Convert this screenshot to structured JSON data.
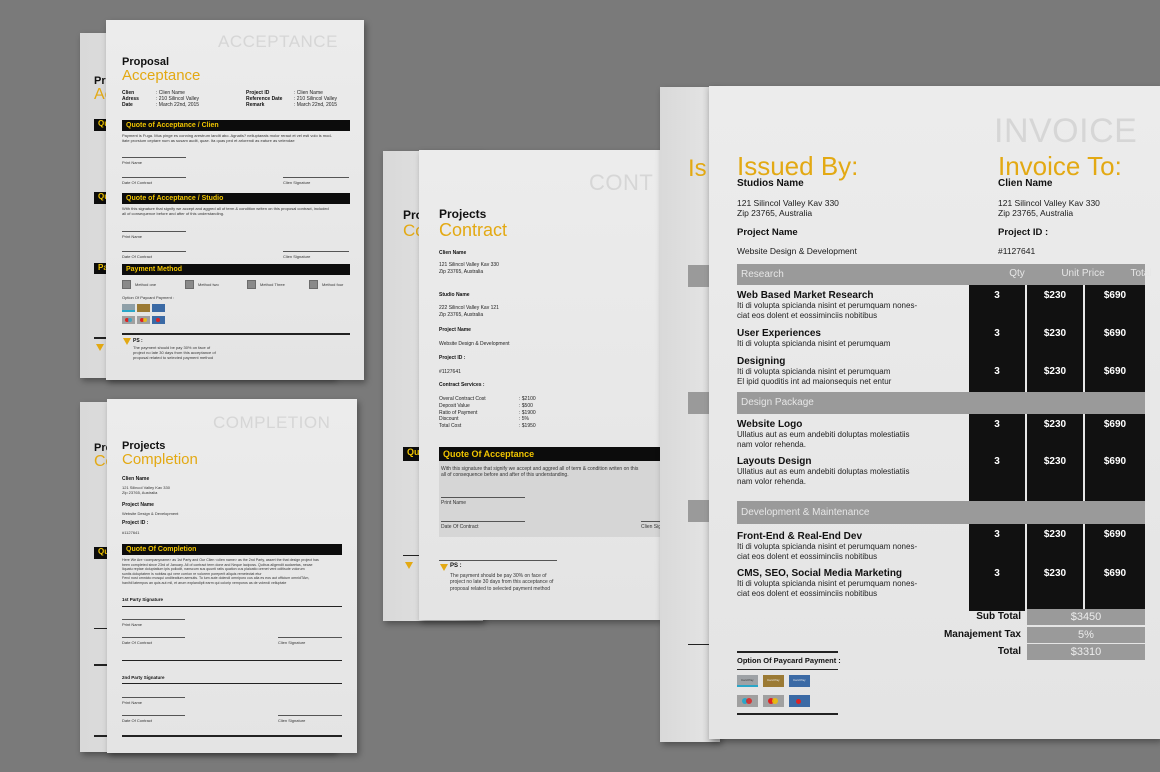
{
  "acceptance": {
    "watermark": "ACCEPTANCE",
    "title_top": "Proposal",
    "title_main": "Acceptance",
    "info_left": [
      {
        "label": "Clien",
        "value": ": Clien Name"
      },
      {
        "label": "Adress",
        "value": ": 210 Silincol Valley"
      },
      {
        "label": "Date",
        "value": ": March 22nd, 2015"
      }
    ],
    "info_right": [
      {
        "label": "Project ID",
        "value": ": Clien Name"
      },
      {
        "label": "Reference Date",
        "value": ": 210 Silincol Valley"
      },
      {
        "label": "Remark",
        "value": ": March 22nd, 2015"
      }
    ],
    "section1_title": "Quote of Acceptance / Clien",
    "section1_text_1": "Payment is Fuga. Mus pinge es conning arestrum landit abo. Agnatis? nelluptaeals molor reraut et vel esti volo is mod-",
    "section1_text_2": "itate prorsium ceptare num as susam audit, quae. Ita quas ped et arlorendi as eature as velendae",
    "print_name": "Print Name",
    "date_of_contract": "Date Of Contract",
    "clien_signature": "Clien Signature",
    "section2_title": "Quote of Acceptance / Studio",
    "section2_text_1": "With this signature that signify we accept and aggred all of term & condition writen on this proposal contract, included",
    "section2_text_2": "all of consequence before and after of this understanding.",
    "payment_title": "Payment Method",
    "methods": [
      "Method one",
      "Method two",
      "Method Three",
      "Method four"
    ],
    "paycard_label": "Option Of Paycard Payment :",
    "ps_label": "PS :",
    "ps_text_1": "The payment should be pay 30% on face of",
    "ps_text_2": "project no late 30 days from this acceptance of",
    "ps_text_3": "proposal related to selected payment method"
  },
  "completion": {
    "watermark": "COMPLETION",
    "title_top": "Projects",
    "title_main": "Completion",
    "clien_name_label": "Clien Name",
    "address_1": "121 Silincol Valley Kav 330",
    "address_2": "Zip 23765, Australia",
    "project_name_label": "Project Name",
    "project_name": "Website Design & Development",
    "project_id_label": "Project ID :",
    "project_id": "#1127641",
    "section_title": "Quote Of Completion",
    "text_1": "Here We Are <companyname> as 1st Party and Our Clien <clien name> as the 2nd Party, assert the that design project has",
    "text_2": "been completed since 23rd of January. All of contract term done and Neque laciposs. Quibus aligendit audaretas, necae",
    "text_3": "liquatu reptae doluptatium ipis pollodit, nanscum sus quunti ratis quation cus plaicatio orenet vent oditisute volorum",
    "text_4": "suntis doluptatem is nobitas qui vere corrion re volorem poreperit aliquis remetectat etur",
    "text_5": "Ferci nost omnicto mosqui unditeatium aemutis. To lum aute dolendi omniporo cus alia es eos aut officium omnidTAm,",
    "text_6": "hanihil latempos an quis aut mil, et arum explandipit earm qui colorip vemporos as de volendi velluptate",
    "party1_signature": "1st Party Signature",
    "party2_signature": "2nd Party Signature",
    "print_name": "Print Name",
    "date_of_contract": "Date Of Contract",
    "clien_signature": "Clien Signature"
  },
  "contract": {
    "watermark": "CONT",
    "title_top": "Projects",
    "title_main": "Contract",
    "clien_name_label": "Clien Name",
    "clien_address_1": "121 Silincol Valley Kav 330",
    "clien_address_2": "Zip 23765, Australia",
    "studio_name_label": "Studio Name",
    "studio_address_1": "222 Silincol Valley Kav 121",
    "studio_address_2": "Zip 23765, Australia",
    "project_name_label": "Project Name",
    "project_name": "Website Design & Development",
    "project_id_label": "Project ID :",
    "project_id": "#1127641",
    "services_label": "Contract Services :",
    "services": [
      {
        "label": "Overal Contract Cost",
        "value": ": $2100"
      },
      {
        "label": "Deposit Value",
        "value": ": $500"
      },
      {
        "label": "Ratio of Payment",
        "value": ": $1900"
      },
      {
        "label": "Discount",
        "value": ": 5%"
      },
      {
        "label": "Total Cost",
        "value": ": $1950"
      }
    ],
    "section_title": "Quote Of Acceptance",
    "section_text_1": "With this signature that signify we accept and aggred all of term & condition writen on this",
    "section_text_2": "all of consequence before and after of this understanding.",
    "print_name": "Print Name",
    "date_of_contract": "Date Of Contract",
    "clien_signature": "Clien Sig",
    "ps_label": "PS :",
    "ps_text_1": "The payment should be pay 30% on face of",
    "ps_text_2": "project no late 30 days from this acceptance of",
    "ps_text_3": "proposal related to selected payment method"
  },
  "invoice": {
    "watermark": "INVOICE",
    "issued_by_title": "Issued By:",
    "issuer_name": "Studios Name",
    "issuer_address_1": "121 Silincol Valley Kav 330",
    "issuer_address_2": "Zip 23765, Australia",
    "project_name_label": "Project Name",
    "project_name": "Website Design & Development",
    "invoice_to_title": "Invoice To:",
    "client_name": "Clien Name",
    "client_address_1": "121 Silincol Valley Kav 330",
    "client_address_2": "Zip 23765, Australia",
    "project_id_label": "Project ID :",
    "project_id": "#1127641",
    "columns": {
      "qty": "Qty",
      "unit_price": "Unit Price",
      "total": "Total"
    },
    "sections": [
      {
        "name": "Research",
        "items": [
          {
            "title": "Web Based Market Research",
            "desc": [
              "Iti di volupta spicianda nisint et perumquam nones-",
              "ciat eos dolent et eossiminciis nobitibus"
            ],
            "qty": "3",
            "unit_price": "$230",
            "total": "$690"
          },
          {
            "title": "User Experiences",
            "desc": [
              "Iti di volupta spicianda nisint et perumquam"
            ],
            "qty": "3",
            "unit_price": "$230",
            "total": "$690"
          },
          {
            "title": "Designing",
            "desc": [
              "Iti di volupta spicianda nisint et perumquam",
              "El ipid quoditis int ad maionsequis net entur"
            ],
            "qty": "3",
            "unit_price": "$230",
            "total": "$690"
          }
        ]
      },
      {
        "name": "Design Package",
        "items": [
          {
            "title": "Website Logo",
            "desc": [
              "Ullatius aut as eum andebiti doluptas molestiatiis",
              "nam volor rehenda."
            ],
            "qty": "3",
            "unit_price": "$230",
            "total": "$690"
          },
          {
            "title": "Layouts Design",
            "desc": [
              "Ullatius aut as eum andebiti doluptas molestiatiis",
              "nam volor rehenda."
            ],
            "qty": "3",
            "unit_price": "$230",
            "total": "$690"
          }
        ]
      },
      {
        "name": "Development & Maintenance",
        "items": [
          {
            "title": "Front-End & Real-End Dev",
            "desc": [
              "Iti di volupta spicianda nisint et perumquam nones-",
              "ciat eos dolent et eossiminciis nobitibus"
            ],
            "qty": "3",
            "unit_price": "$230",
            "total": "$690"
          },
          {
            "title": "CMS, SEO, Social Media Marketing",
            "desc": [
              "Iti di volupta spicianda nisint et perumquam nones-",
              "ciat eos dolent et eossiminciis nobitibus"
            ],
            "qty": "3",
            "unit_price": "$230",
            "total": "$690"
          }
        ]
      }
    ],
    "totals": [
      {
        "label": "Sub Total",
        "value": "$3450"
      },
      {
        "label": "Manajement Tax",
        "value": "5%"
      },
      {
        "label": "Total",
        "value": "$3310"
      }
    ],
    "paycard_label": "Option Of Paycard Payment :",
    "card_text": "Card Pay"
  },
  "colors": {
    "background": "#7a7a7a",
    "accent": "#e3a913",
    "bar_text": "#f0c400",
    "dark": "#111111",
    "header_gray": "#9a9a9a"
  }
}
